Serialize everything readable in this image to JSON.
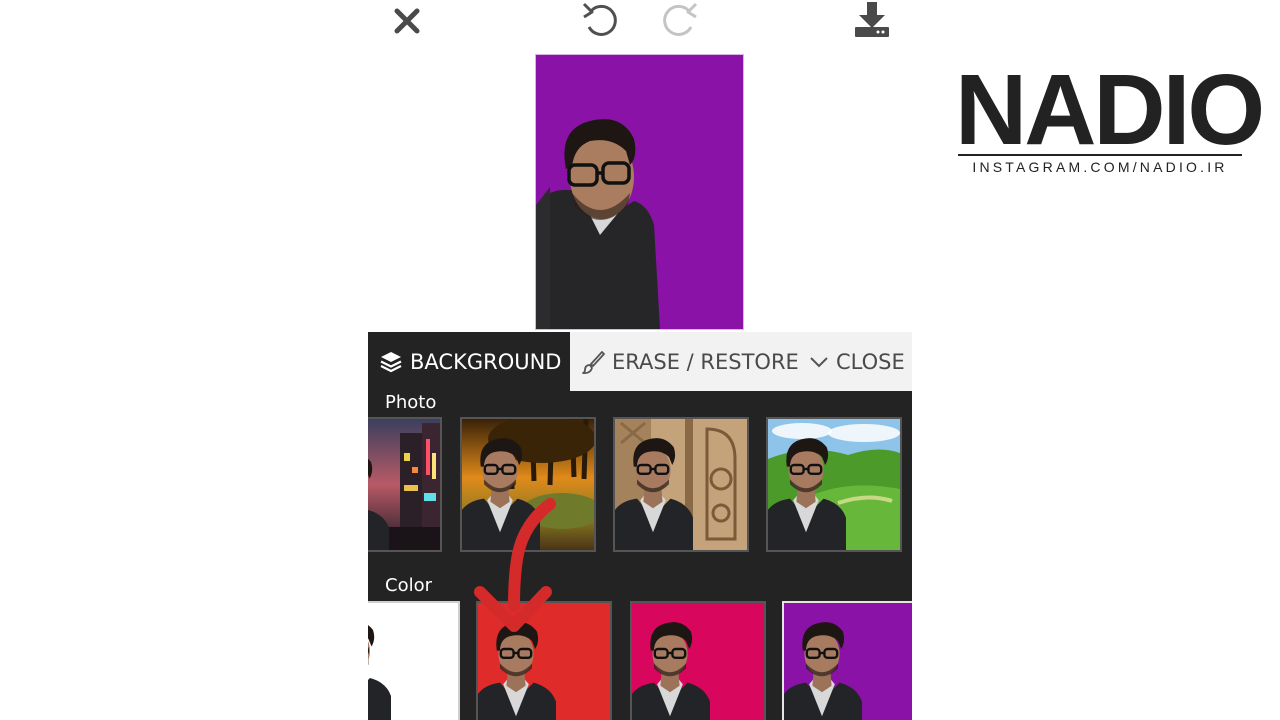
{
  "toolbar": {
    "close_icon": "close-icon",
    "undo_icon": "undo-icon",
    "redo_icon": "redo-icon",
    "download_icon": "download-icon"
  },
  "preview": {
    "background_color": "#8a12a6"
  },
  "watermark": {
    "wordmark": "NADIO",
    "handle": "INSTAGRAM.COM/NADIO.IR"
  },
  "panel": {
    "tabs": [
      {
        "label": "BACKGROUND",
        "icon": "layers-icon",
        "active": true
      },
      {
        "label": "ERASE / RESTORE",
        "icon": "brush-icon",
        "active": false
      },
      {
        "label": "CLOSE",
        "icon": "chevron-down-icon",
        "active": false
      }
    ],
    "photo_section": {
      "label": "Photo",
      "items": [
        "city-night",
        "sunset-forest",
        "carved-door",
        "green-hills"
      ]
    },
    "color_section": {
      "label": "Color",
      "items": [
        {
          "name": "white",
          "color": "#ffffff"
        },
        {
          "name": "red",
          "color": "#e02b2b"
        },
        {
          "name": "pink",
          "color": "#d8065c"
        },
        {
          "name": "purple",
          "color": "#8a12a6",
          "selected": true
        }
      ]
    }
  },
  "colors": {
    "panel_bg": "#232323",
    "tab_inactive_bg": "#f2f2f2",
    "annotation_arrow": "#d42a2a"
  }
}
